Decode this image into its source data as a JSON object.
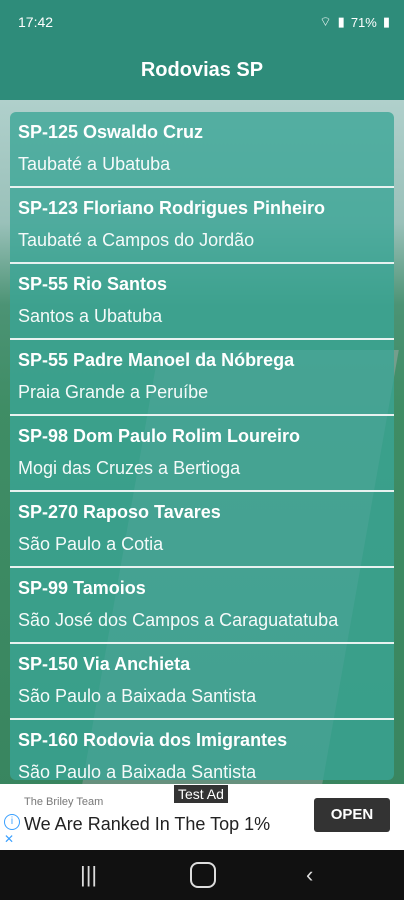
{
  "status": {
    "time": "17:42",
    "battery": "71%"
  },
  "header": {
    "title": "Rodovias SP"
  },
  "routes": [
    {
      "title": "SP-125  Oswaldo Cruz",
      "subtitle": "Taubaté a Ubatuba"
    },
    {
      "title": "SP-123  Floriano Rodrigues Pinheiro",
      "subtitle": "Taubaté a Campos do Jordão"
    },
    {
      "title": "SP-55  Rio Santos",
      "subtitle": "Santos a Ubatuba"
    },
    {
      "title": "SP-55  Padre Manoel da Nóbrega",
      "subtitle": "Praia Grande a Peruíbe"
    },
    {
      "title": "SP-98  Dom Paulo Rolim Loureiro",
      "subtitle": "Mogi das Cruzes a Bertioga"
    },
    {
      "title": "SP-270  Raposo Tavares",
      "subtitle": "São Paulo a Cotia"
    },
    {
      "title": "SP-99  Tamoios",
      "subtitle": "São José dos Campos a Caraguatatuba"
    },
    {
      "title": "SP-150  Via Anchieta",
      "subtitle": "São Paulo a Baixada Santista"
    },
    {
      "title": "SP-160  Rodovia dos Imigrantes",
      "subtitle": "São Paulo a Baixada Santista"
    }
  ],
  "ad": {
    "label": "Test Ad",
    "brand": "The Briley Team",
    "headline": "We Are Ranked In The Top 1%",
    "cta": "OPEN"
  },
  "icons": {
    "info": "info-icon",
    "close": "close-icon"
  }
}
